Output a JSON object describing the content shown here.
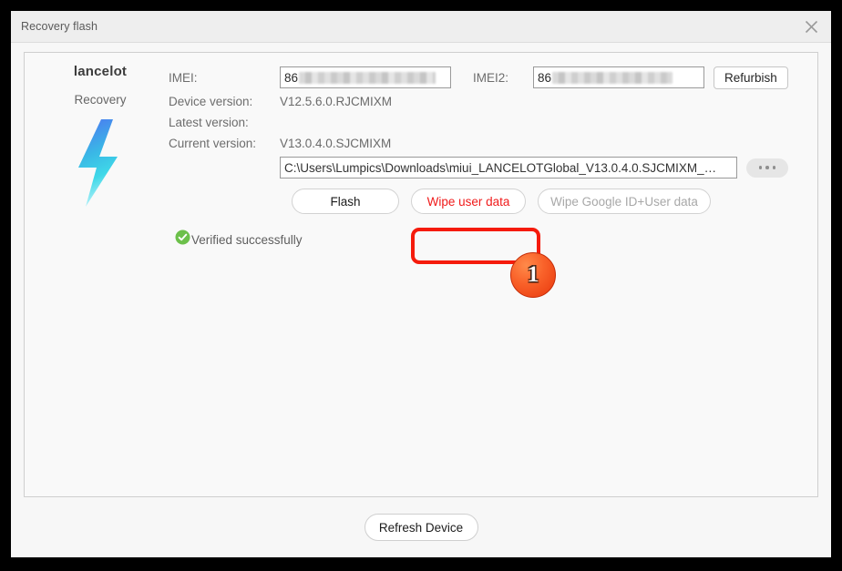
{
  "window": {
    "title": "Recovery flash",
    "close_icon": "close-icon"
  },
  "device": {
    "name": "lancelot",
    "mode": "Recovery",
    "icon": "lightning-bolt-icon",
    "bolt_gradient": [
      "#4a7ef0",
      "#3fd8e8",
      "#c8f5fb"
    ]
  },
  "info": {
    "imei_label": "IMEI:",
    "imei_value": "86",
    "imei2_label": "IMEI2:",
    "imei2_value": "86",
    "device_version_label": "Device version:",
    "device_version_value": "V12.5.6.0.RJCMIXM",
    "latest_version_label": "Latest version:",
    "latest_version_value": "",
    "current_version_label": "Current version:",
    "current_version_value": "V13.0.4.0.SJCMIXM",
    "refurbish_label": "Refurbish",
    "firmware_path": "C:\\Users\\Lumpics\\Downloads\\miui_LANCELOTGlobal_V13.0.4.0.SJCMIXM_…",
    "browse_icon": "ellipsis-icon"
  },
  "actions": {
    "flash_label": "Flash",
    "wipe_user_data_label": "Wipe user data",
    "wipe_google_label": "Wipe Google ID+User data",
    "highlight_color": "#f51b0c",
    "step_number": "1"
  },
  "status": {
    "icon": "check-circle-icon",
    "text": "Verified successfully",
    "color": "#6cc04a"
  },
  "footer": {
    "refresh_label": "Refresh Device"
  }
}
